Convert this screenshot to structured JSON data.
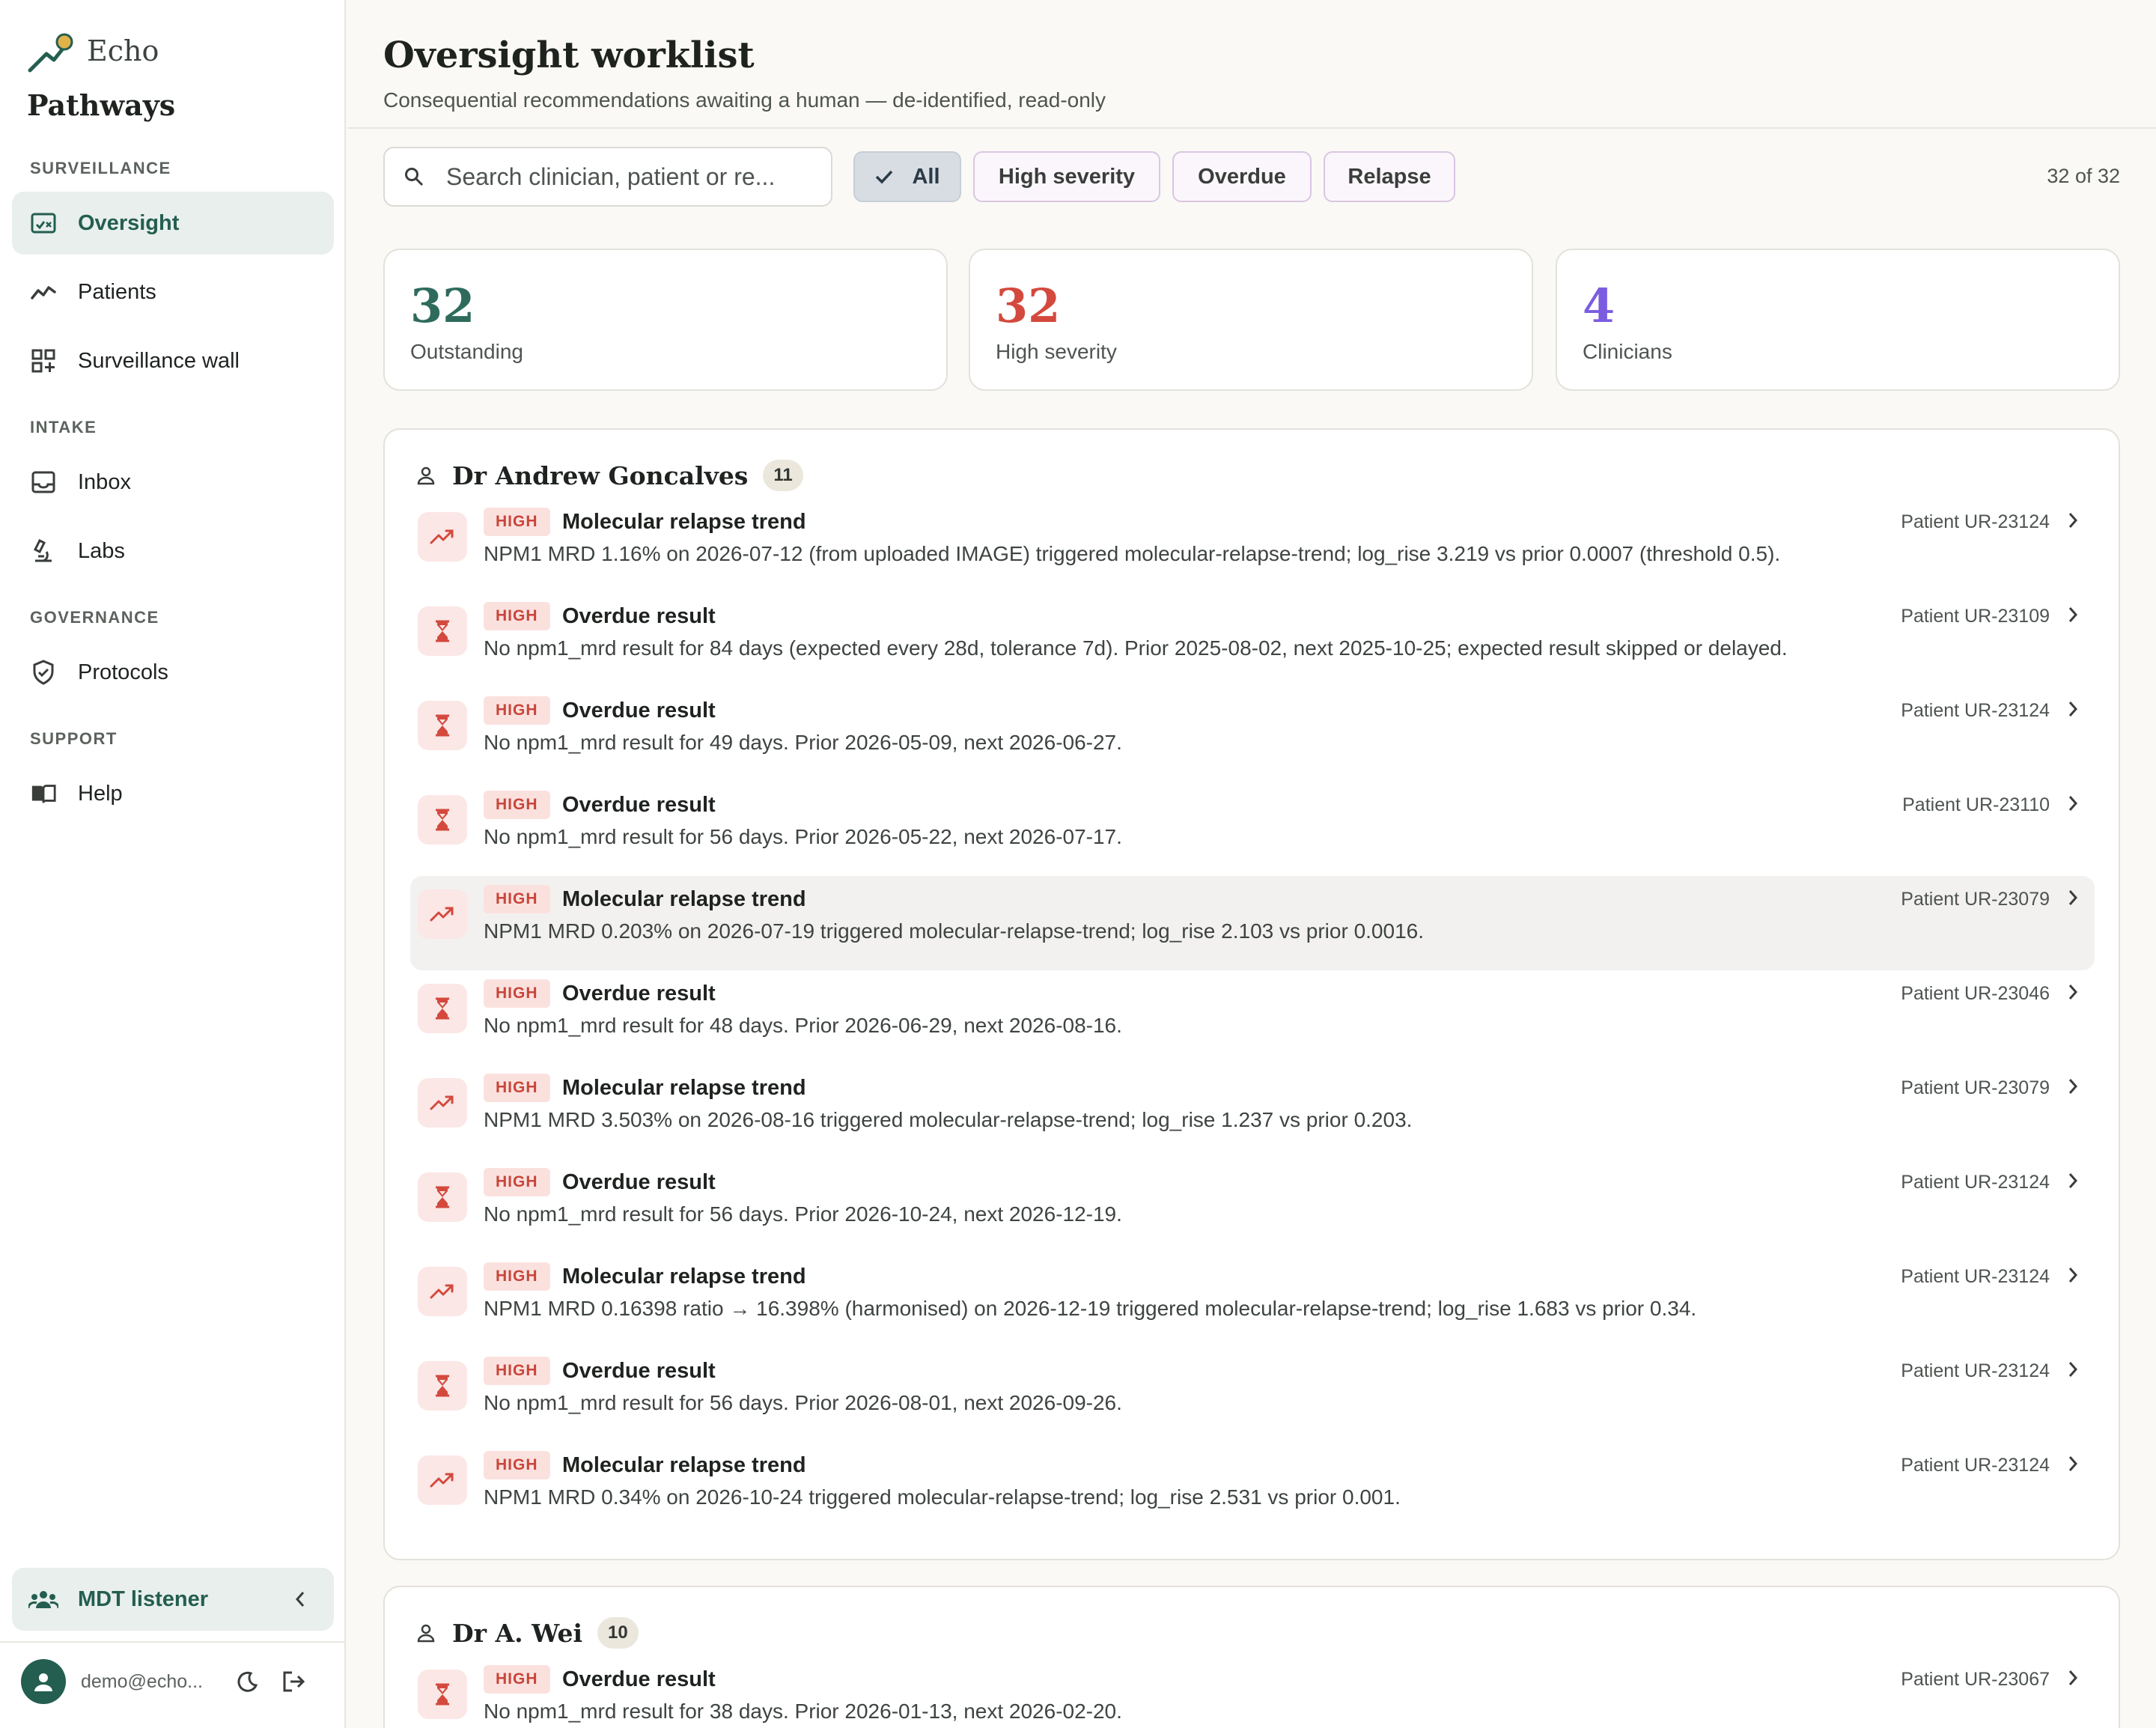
{
  "brand": {
    "name_top": "Echo",
    "name_bottom": "Pathways"
  },
  "nav": {
    "sections": {
      "surveillance": "SURVEILLANCE",
      "intake": "INTAKE",
      "governance": "GOVERNANCE",
      "support": "SUPPORT"
    },
    "items": {
      "oversight": "Oversight",
      "patients": "Patients",
      "surveillance_wall": "Surveillance wall",
      "inbox": "Inbox",
      "labs": "Labs",
      "protocols": "Protocols",
      "help": "Help"
    },
    "active": "oversight"
  },
  "mdt_listener": {
    "label": "MDT listener"
  },
  "user": {
    "email": "demo@echo..."
  },
  "page": {
    "title": "Oversight worklist",
    "subtitle": "Consequential recommendations awaiting a human — de-identified, read-only"
  },
  "search": {
    "placeholder": "Search clinician, patient or re...",
    "value": ""
  },
  "filters": {
    "all": "All",
    "high_severity": "High severity",
    "overdue": "Overdue",
    "relapse": "Relapse",
    "selected": "all"
  },
  "count_text": "32 of 32",
  "stats": {
    "outstanding": {
      "value": "32",
      "label": "Outstanding",
      "color": "#2f6b5c"
    },
    "high_severity": {
      "value": "32",
      "label": "High severity",
      "color": "#d4493d"
    },
    "clinicians": {
      "value": "4",
      "label": "Clinicians",
      "color": "#7b5ce0"
    }
  },
  "colors": {
    "accent": "#245e50",
    "high": "#c9453a",
    "high_bg": "#fbe1de"
  },
  "groups": [
    {
      "clinician": "Dr Andrew Goncalves",
      "count": "11",
      "items": [
        {
          "icon": "trend-up-icon",
          "severity": "HIGH",
          "title": "Molecular relapse trend",
          "patient": "Patient UR-23124",
          "description": "NPM1 MRD 1.16% on 2026-07-12 (from uploaded IMAGE) triggered molecular-relapse-trend; log_rise 3.219 vs prior 0.0007 (threshold 0.5)."
        },
        {
          "icon": "hourglass-icon",
          "severity": "HIGH",
          "title": "Overdue result",
          "patient": "Patient UR-23109",
          "description": "No npm1_mrd result for 84 days (expected every 28d, tolerance 7d). Prior 2025-08-02, next 2025-10-25; expected result skipped or delayed."
        },
        {
          "icon": "hourglass-icon",
          "severity": "HIGH",
          "title": "Overdue result",
          "patient": "Patient UR-23124",
          "description": "No npm1_mrd result for 49 days. Prior 2026-05-09, next 2026-06-27."
        },
        {
          "icon": "hourglass-icon",
          "severity": "HIGH",
          "title": "Overdue result",
          "patient": "Patient UR-23110",
          "description": "No npm1_mrd result for 56 days. Prior 2026-05-22, next 2026-07-17."
        },
        {
          "icon": "trend-up-icon",
          "severity": "HIGH",
          "title": "Molecular relapse trend",
          "patient": "Patient UR-23079",
          "description": "NPM1 MRD 0.203% on 2026-07-19 triggered molecular-relapse-trend; log_rise 2.103 vs prior 0.0016."
        },
        {
          "icon": "hourglass-icon",
          "severity": "HIGH",
          "title": "Overdue result",
          "patient": "Patient UR-23046",
          "description": "No npm1_mrd result for 48 days. Prior 2026-06-29, next 2026-08-16."
        },
        {
          "icon": "trend-up-icon",
          "severity": "HIGH",
          "title": "Molecular relapse trend",
          "patient": "Patient UR-23079",
          "description": "NPM1 MRD 3.503% on 2026-08-16 triggered molecular-relapse-trend; log_rise 1.237 vs prior 0.203."
        },
        {
          "icon": "hourglass-icon",
          "severity": "HIGH",
          "title": "Overdue result",
          "patient": "Patient UR-23124",
          "description": "No npm1_mrd result for 56 days. Prior 2026-10-24, next 2026-12-19."
        },
        {
          "icon": "trend-up-icon",
          "severity": "HIGH",
          "title": "Molecular relapse trend",
          "patient": "Patient UR-23124",
          "description": "NPM1 MRD 0.16398 ratio → 16.398% (harmonised) on 2026-12-19 triggered molecular-relapse-trend; log_rise 1.683 vs prior 0.34."
        },
        {
          "icon": "hourglass-icon",
          "severity": "HIGH",
          "title": "Overdue result",
          "patient": "Patient UR-23124",
          "description": "No npm1_mrd result for 56 days. Prior 2026-08-01, next 2026-09-26."
        },
        {
          "icon": "trend-up-icon",
          "severity": "HIGH",
          "title": "Molecular relapse trend",
          "patient": "Patient UR-23124",
          "description": "NPM1 MRD 0.34% on 2026-10-24 triggered molecular-relapse-trend; log_rise 2.531 vs prior 0.001."
        }
      ]
    },
    {
      "clinician": "Dr A. Wei",
      "count": "10",
      "items": [
        {
          "icon": "hourglass-icon",
          "severity": "HIGH",
          "title": "Overdue result",
          "patient": "Patient UR-23067",
          "description": "No npm1_mrd result for 38 days. Prior 2026-01-13, next 2026-02-20."
        }
      ]
    }
  ]
}
